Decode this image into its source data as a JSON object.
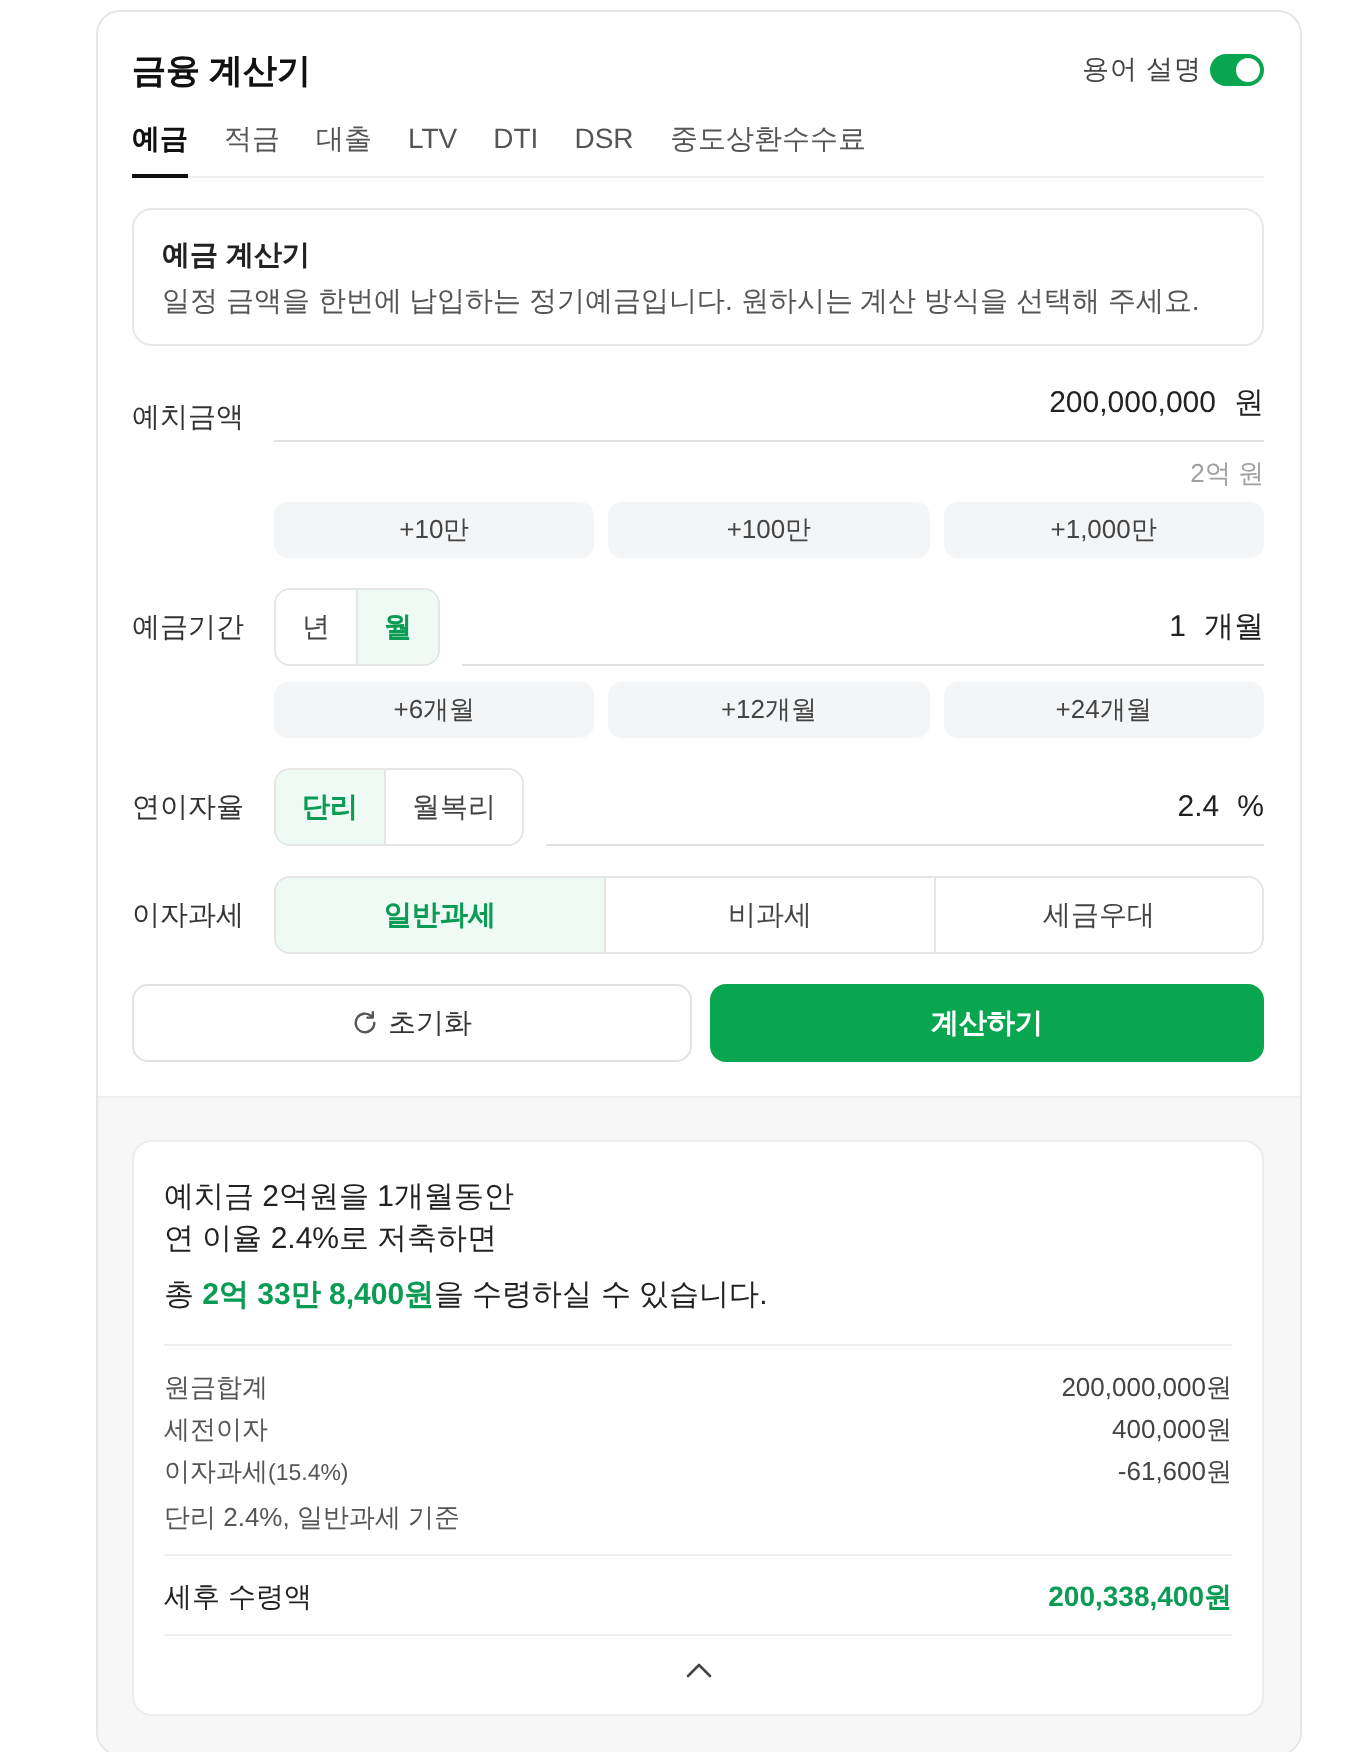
{
  "header": {
    "title": "금융 계산기",
    "toggle": {
      "label": "용어 설명",
      "on": true
    }
  },
  "tabs": [
    {
      "label": "예금",
      "selected": true
    },
    {
      "label": "적금",
      "selected": false
    },
    {
      "label": "대출",
      "selected": false
    },
    {
      "label": "LTV",
      "selected": false
    },
    {
      "label": "DTI",
      "selected": false
    },
    {
      "label": "DSR",
      "selected": false
    },
    {
      "label": "중도상환수수료",
      "selected": false
    }
  ],
  "info": {
    "title": "예금 계산기",
    "description": "일정 금액을 한번에 납입하는 정기예금입니다. 원하시는 계산 방식을 선택해 주세요."
  },
  "amount": {
    "label": "예치금액",
    "value": "200,000,000",
    "unit": "원",
    "hint": "2억 원",
    "quick": [
      "+10만",
      "+100만",
      "+1,000만"
    ]
  },
  "period": {
    "label": "예금기간",
    "options": [
      {
        "label": "년",
        "selected": false
      },
      {
        "label": "월",
        "selected": true
      }
    ],
    "value": "1",
    "unit": "개월",
    "quick": [
      "+6개월",
      "+12개월",
      "+24개월"
    ]
  },
  "rate": {
    "label": "연이자율",
    "options": [
      {
        "label": "단리",
        "selected": true
      },
      {
        "label": "월복리",
        "selected": false
      }
    ],
    "value": "2.4",
    "unit": "%"
  },
  "tax": {
    "label": "이자과세",
    "options": [
      {
        "label": "일반과세",
        "selected": true
      },
      {
        "label": "비과세",
        "selected": false
      },
      {
        "label": "세금우대",
        "selected": false
      }
    ]
  },
  "buttons": {
    "reset": "초기화",
    "calculate": "계산하기"
  },
  "result": {
    "lines": [
      "예치금 2억원을 1개월동안",
      "연 이율 2.4%로 저축하면"
    ],
    "total": "총 **2억 33만 8,400원**을 수령하실 수 있습니다.",
    "expanded": true,
    "details": [
      {
        "label": "원금합계",
        "value": "200,000,000원"
      },
      {
        "label": "세전이자",
        "value": "400,000원"
      },
      {
        "label": "이자과세",
        "note": "(15.4%)",
        "value": "-61,600원"
      },
      {
        "label": "단리 2.4%, 일반과세 기준"
      }
    ],
    "net": {
      "label": "세후 수령액",
      "value": "200,338,400원"
    }
  }
}
